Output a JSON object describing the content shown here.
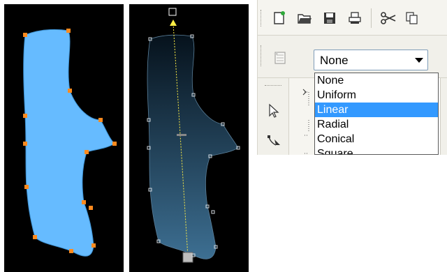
{
  "colors": {
    "panel_background": "#000000",
    "shape_fill": "#66bbff",
    "node_color": "#ff8a1e",
    "gradient_top": "#06121c",
    "gradient_bottom": "#3d6f92",
    "gradient_vector": "#ffee44",
    "selection_highlight": "#3399ff"
  },
  "toolbar": {
    "buttons": [
      {
        "name": "new-document-icon"
      },
      {
        "name": "open-folder-icon"
      },
      {
        "name": "save-icon"
      },
      {
        "name": "print-icon"
      },
      {
        "name": "cut-icon"
      },
      {
        "name": "copy-icon"
      }
    ]
  },
  "property_bar": {
    "fill_type_icon": "fill-type-icon",
    "fill_select": {
      "value": "None",
      "options": [
        "None",
        "Uniform",
        "Linear",
        "Radial",
        "Conical",
        "Square"
      ],
      "highlighted": "Linear"
    }
  },
  "toolbox": {
    "tools": [
      {
        "name": "pick-tool-icon"
      },
      {
        "name": "shape-tool-icon"
      }
    ]
  }
}
